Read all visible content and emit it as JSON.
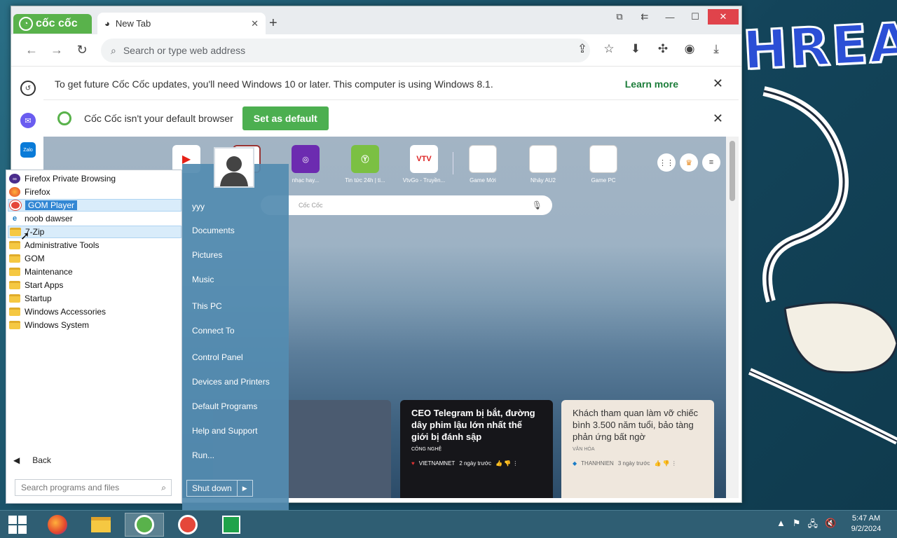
{
  "browser": {
    "brand": "cốc cốc",
    "tab_title": "New Tab",
    "omnibox_placeholder": "Search or type web address",
    "update_notice": "To get future Cốc Cốc updates, you'll need Windows 10 or later. This computer is using Windows 8.1.",
    "learn_more": "Learn more",
    "default_notice": "Cốc Cốc isn't your default browser",
    "set_default": "Set as default",
    "speed_dial": [
      {
        "label": "",
        "icon": "youtube-icon"
      },
      {
        "label": "",
        "icon": "avatar-icon"
      },
      {
        "label": "nhạc hay...",
        "icon": "music-icon"
      },
      {
        "label": "Tin tức 24h | ti...",
        "icon": "news-icon"
      },
      {
        "label": "VtvGo - Truyền...",
        "icon": "vtv-icon"
      },
      {
        "label": "Game Mới",
        "icon": "blank-icon"
      },
      {
        "label": "Nhảy AU2",
        "icon": "blank-icon"
      },
      {
        "label": "Game PC",
        "icon": "blank-icon"
      }
    ],
    "content_search_placeholder": "Cốc Cốc",
    "cards": [
      {
        "title": "CEO Telegram bị bắt, đường dây phim lậu lớn nhất thế giới bị đánh sập",
        "category": "CÔNG NGHỆ",
        "source": "VIETNAMNET",
        "time": "2 ngày trước"
      },
      {
        "title": "Khách tham quan làm vỡ chiếc bình 3.500 năm tuổi, bảo tàng phản ứng bất ngờ",
        "category": "VĂN HÓA",
        "source": "THANHNIEN",
        "time": "3 ngày trước"
      }
    ]
  },
  "start_menu": {
    "programs": [
      {
        "label": "Firefox Private Browsing",
        "icon": "firefox-private-icon"
      },
      {
        "label": "Firefox",
        "icon": "firefox-icon"
      },
      {
        "label": "GOM Player",
        "icon": "gom-player-icon"
      },
      {
        "label": "noob dawser",
        "icon": "ie-icon"
      },
      {
        "label": "7-Zip",
        "icon": "folder-icon"
      },
      {
        "label": "Administrative Tools",
        "icon": "folder-icon"
      },
      {
        "label": "GOM",
        "icon": "folder-icon"
      },
      {
        "label": "Maintenance",
        "icon": "folder-icon"
      },
      {
        "label": "Start Apps",
        "icon": "folder-icon"
      },
      {
        "label": "Startup",
        "icon": "folder-icon"
      },
      {
        "label": "Windows Accessories",
        "icon": "folder-icon"
      },
      {
        "label": "Windows System",
        "icon": "folder-icon"
      }
    ],
    "back": "Back",
    "search_placeholder": "Search programs and files",
    "right_items": [
      "yyy",
      "Documents",
      "Pictures",
      "Music",
      "This PC",
      "Connect To",
      "Control Panel",
      "Devices and Printers",
      "Default Programs",
      "Help and Support",
      "Run..."
    ],
    "shutdown": "Shut down"
  },
  "taskbar": {
    "time": "5:47 AM",
    "date": "9/2/2024"
  },
  "wallpaper": {
    "text": "HREAT"
  }
}
